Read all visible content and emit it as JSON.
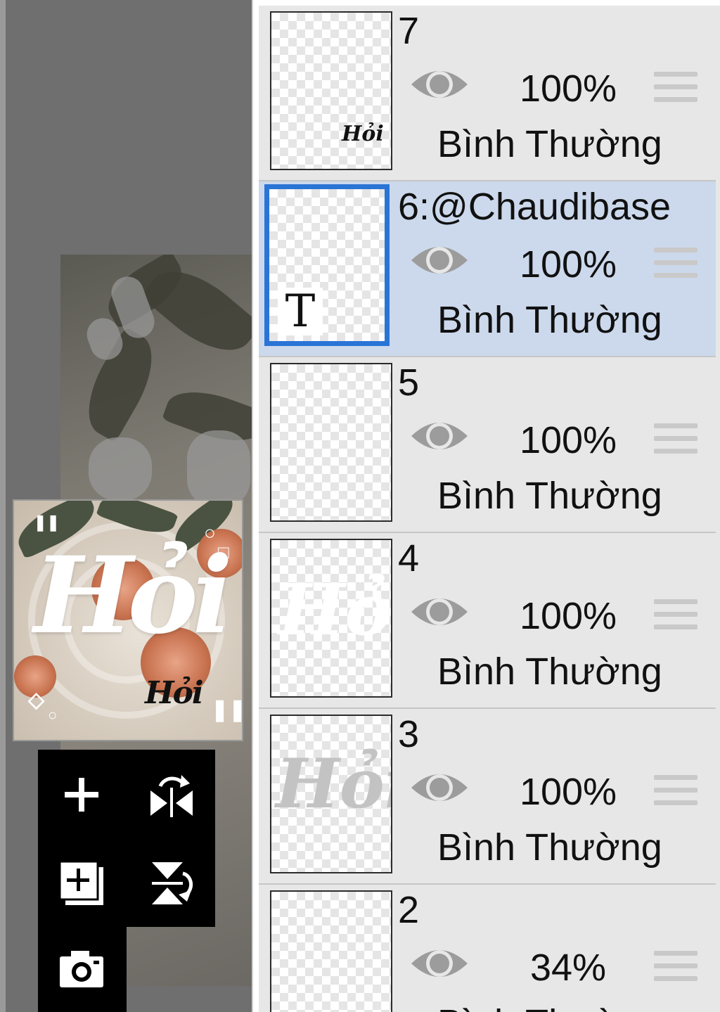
{
  "preview": {
    "title_art": "Hỏi",
    "subtitle_art": "Hỏi"
  },
  "tools": {
    "add_layer_icon": "plus-icon",
    "flip_horizontal_icon": "flip-horizontal-icon",
    "add_copy_icon": "add-copy-icon",
    "flip_vertical_icon": "flip-vertical-icon",
    "camera_icon": "camera-icon"
  },
  "layers": [
    {
      "name": "7",
      "opacity": "100%",
      "blend": "Bình Thường",
      "selected": false,
      "thumb_art": "Hỏi"
    },
    {
      "name": "6:@Chaudibase",
      "opacity": "100%",
      "blend": "Bình Thường",
      "selected": true,
      "thumb_badge": "T"
    },
    {
      "name": "5",
      "opacity": "100%",
      "blend": "Bình Thường",
      "selected": false
    },
    {
      "name": "4",
      "opacity": "100%",
      "blend": "Bình Thường",
      "selected": false,
      "thumb_art": "Hỏi"
    },
    {
      "name": "3",
      "opacity": "100%",
      "blend": "Bình Thường",
      "selected": false,
      "thumb_art": "Hỏi"
    },
    {
      "name": "2",
      "opacity": "34%",
      "blend": "Bình Thường",
      "selected": false
    }
  ],
  "colors": {
    "selected_row": "#ccd9ec",
    "selected_border": "#2a74d6",
    "row_background": "#e7e7e7"
  }
}
